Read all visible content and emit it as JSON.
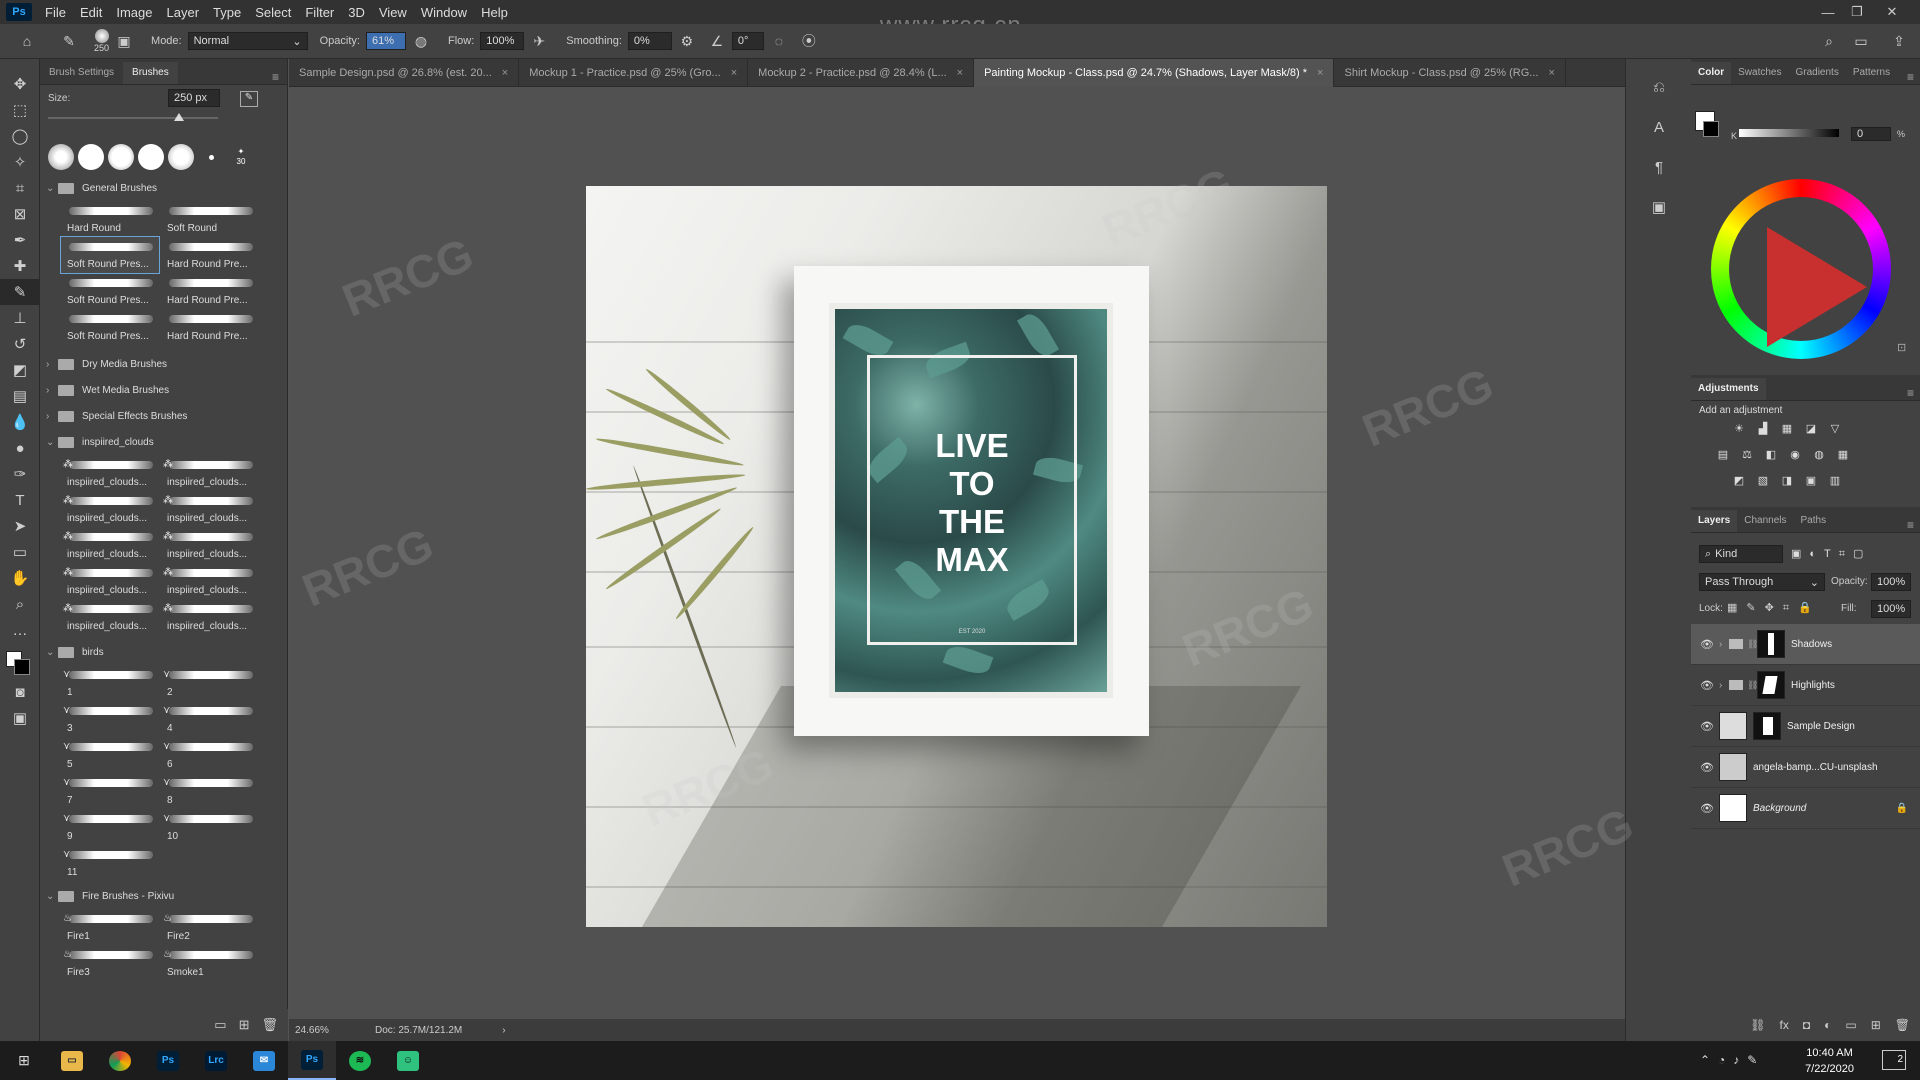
{
  "app": {
    "logo": "Ps",
    "watermark": "www.rrcg.cn"
  },
  "menu": [
    "File",
    "Edit",
    "Image",
    "Layer",
    "Type",
    "Select",
    "Filter",
    "3D",
    "View",
    "Window",
    "Help"
  ],
  "options": {
    "brush_size": "250",
    "mode_label": "Mode:",
    "mode_value": "Normal",
    "opacity_label": "Opacity:",
    "opacity_value": "61%",
    "flow_label": "Flow:",
    "flow_value": "100%",
    "smoothing_label": "Smoothing:",
    "smoothing_value": "0%",
    "angle_value": "0°"
  },
  "brush_panel": {
    "tabs": [
      "Brush Settings",
      "Brushes"
    ],
    "size_label": "Size:",
    "size_value": "250 px",
    "preset_count": "30",
    "folders": {
      "general": "General Brushes",
      "dry": "Dry Media Brushes",
      "wet": "Wet Media Brushes",
      "special": "Special Effects Brushes",
      "clouds": "inspiired_clouds",
      "birds": "birds",
      "fire": "Fire Brushes - Pixivu"
    },
    "general_brushes": [
      "Hard Round",
      "Soft Round",
      "Soft Round Pres...",
      "Hard Round Pre...",
      "Soft Round Pres...",
      "Hard Round Pre...",
      "Soft Round Pres...",
      "Hard Round Pre..."
    ],
    "cloud_brushes": [
      "inspiired_clouds...",
      "inspiired_clouds...",
      "inspiired_clouds...",
      "inspiired_clouds...",
      "inspiired_clouds...",
      "inspiired_clouds...",
      "inspiired_clouds...",
      "inspiired_clouds...",
      "inspiired_clouds...",
      "inspiired_clouds..."
    ],
    "bird_brushes": [
      "1",
      "2",
      "3",
      "4",
      "5",
      "6",
      "7",
      "8",
      "9",
      "10",
      "11"
    ],
    "fire_brushes": [
      "Fire1",
      "Fire2",
      "Fire3",
      "Smoke1"
    ]
  },
  "doc_tabs": [
    "Sample Design.psd @ 26.8% (est. 20...",
    "Mockup 1 - Practice.psd @ 25% (Gro...",
    "Mockup 2 - Practice.psd @ 28.4% (L...",
    "Painting Mockup - Class.psd @ 24.7% (Shadows, Layer Mask/8) *",
    "Shirt Mockup - Class.psd @ 25% (RG..."
  ],
  "poster": {
    "title_lines": [
      "LIVE",
      "TO",
      "THE",
      "MAX"
    ],
    "est": "EST 2020"
  },
  "status": {
    "zoom": "24.66%",
    "doc": "Doc: 25.7M/121.2M"
  },
  "right_panel": {
    "color_tabs": [
      "Color",
      "Swatches",
      "Gradients",
      "Patterns"
    ],
    "k_value": "0",
    "adjustments_title": "Adjustments",
    "adjustments_hint": "Add an adjustment",
    "layers_tabs": [
      "Layers",
      "Channels",
      "Paths"
    ],
    "kind_label": "Kind",
    "blend_mode": "Pass Through",
    "opacity_label": "Opacity:",
    "opacity_value": "100%",
    "lock_label": "Lock:",
    "fill_label": "Fill:",
    "fill_value": "100%",
    "layers": [
      "Shadows",
      "Highlights",
      "Sample Design",
      "angela-bamp...CU-unsplash",
      "Background"
    ]
  },
  "taskbar": {
    "time": "10:40 AM",
    "date": "7/22/2020",
    "notifications": "2"
  },
  "colors": {
    "accent": "#31a8ff",
    "panel": "#424242",
    "canvas": "#535353"
  }
}
